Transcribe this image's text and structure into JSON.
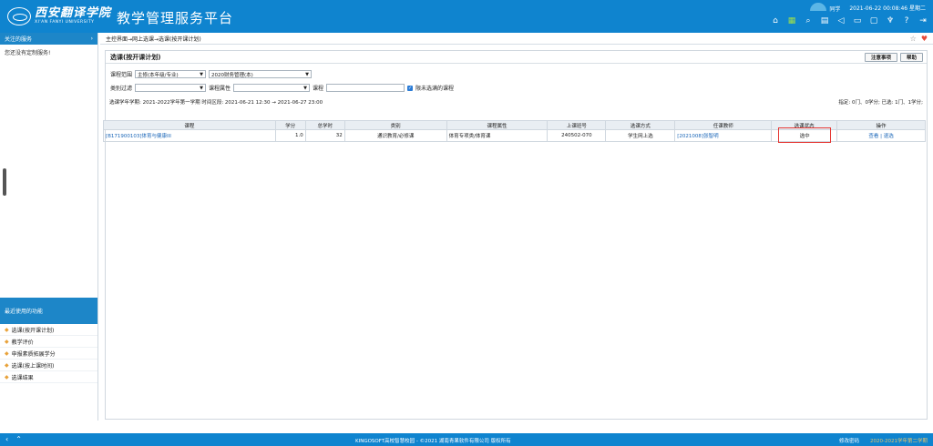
{
  "header": {
    "logo_cn": "西安翻译学院",
    "logo_en": "XI'AN FANYI UNIVERSITY",
    "platform_title": "教学管理服务平台",
    "user_label": "同学",
    "datetime": "2021-06-22 00:08:46 星期二",
    "icons": [
      "home-icon",
      "apps-icon",
      "search-icon",
      "calendar-icon",
      "volume-icon",
      "window-icon",
      "message-icon",
      "shirt-icon",
      "help-icon",
      "logout-icon"
    ]
  },
  "sidebar": {
    "follow_title": "关注的服务",
    "follow_arrow": "›",
    "follow_empty": "您还没有定制服务!",
    "recent_title": "最近使用的功能",
    "recent_items": [
      "选课(按开课计划)",
      "教学评价",
      "申报素质拓展学分",
      "选课(按上课时间)",
      "选课结果"
    ]
  },
  "main": {
    "breadcrumb": "主控界面→网上选课→选课(按开课计划)",
    "panel_title": "选课(按开课计划)",
    "buttons": {
      "notice": "注意事项",
      "help": "帮助"
    },
    "filters": {
      "scope_label": "课程范围",
      "scope_value": "主修(本年级/专业)",
      "major_value": "2020财务管理(本)",
      "category_label": "类别过滤",
      "category_value": "",
      "attr_label": "课程属性",
      "attr_value": "",
      "course_label": "课程",
      "course_value": "",
      "limit_label": "限未选满的课程"
    },
    "info_left": "选课学年学期: 2021-2022学年第一学期  时间区段: 2021-06-21 12:30 → 2021-06-27 23:00",
    "info_right": "指定: 0门、0学分; 已选: 1门、1学分;",
    "table": {
      "headers": [
        "课程",
        "学分",
        "总学时",
        "类别",
        "课程属性",
        "上课班号",
        "选课方式",
        "任课教师",
        "选课状态",
        "操作"
      ],
      "rows": [
        {
          "course": "[B171900103]体育与健康III",
          "credit": "1.0",
          "hours": "32",
          "category": "通识教育/必修课",
          "attr": "体育专项类/体育课",
          "class_no": "240502-070",
          "method": "学生网上选",
          "teacher": "[2021008]张智明",
          "status": "选中",
          "op_view": "查看",
          "op_sep": "|",
          "op_drop": "退选"
        }
      ]
    }
  },
  "footer": {
    "nav_prev": "‹",
    "nav_up": "⌃",
    "copyright": "KINGOSOFT高校智慧校园 - ©2021 湖南青果软件有限公司 版权所有",
    "change_password": "修改密码",
    "term": "2020-2021学年第二学期"
  },
  "colors": {
    "brand": "#0f84cf",
    "highlight": "#e53935",
    "link": "#1a66b8"
  }
}
